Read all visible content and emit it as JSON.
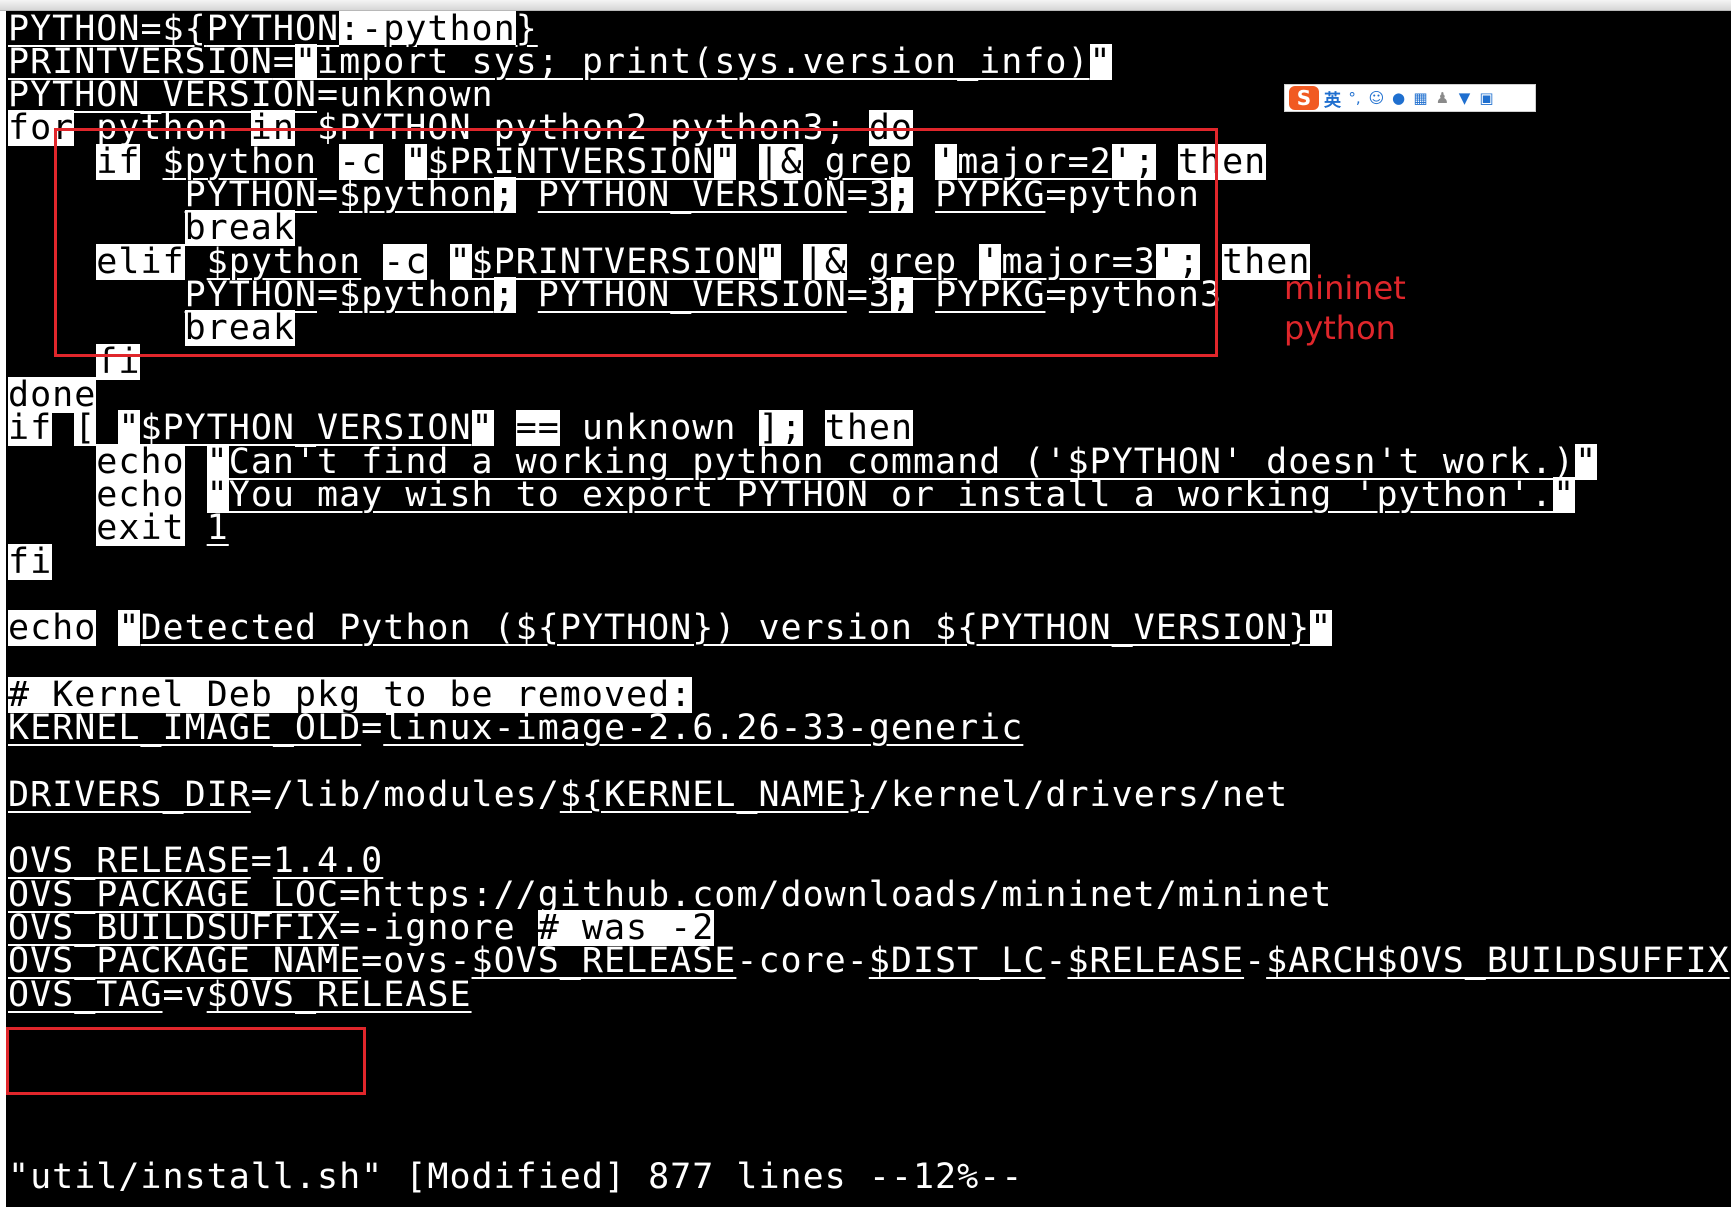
{
  "editor": {
    "lines": [
      {
        "segs": [
          {
            "t": "PYTHON",
            "u": 1
          },
          {
            "t": "=",
            "u": 1
          },
          {
            "t": "${",
            "u": 1
          },
          {
            "t": "PYTHON",
            "u": 1
          },
          {
            "t": ":-python",
            "u": 1,
            "h": 1
          },
          {
            "t": "}",
            "u": 1
          }
        ]
      },
      {
        "segs": [
          {
            "t": "PRINTVERSION",
            "u": 1
          },
          {
            "t": "=",
            "u": 1
          },
          {
            "t": "\"",
            "h": 1
          },
          {
            "t": "import sys; print(sys.version_info)",
            "u": 1
          },
          {
            "t": "\"",
            "h": 1
          }
        ]
      },
      {
        "segs": [
          {
            "t": "PYTHON_VERSION",
            "u": 1
          },
          {
            "t": "=unknown"
          }
        ]
      },
      {
        "segs": [
          {
            "t": "for",
            "h": 1
          },
          {
            "t": " python "
          },
          {
            "t": "in",
            "h": 1
          },
          {
            "t": " $PYTHON python2 python3; "
          },
          {
            "t": "do",
            "h": 1
          }
        ]
      },
      {
        "segs": [
          {
            "t": "    "
          },
          {
            "t": "if",
            "h": 1
          },
          {
            "t": " "
          },
          {
            "t": "$python",
            "u": 1
          },
          {
            "t": " "
          },
          {
            "t": "-c",
            "h": 1
          },
          {
            "t": " "
          },
          {
            "t": "\"",
            "h": 1
          },
          {
            "t": "$PRINTVERSION",
            "u": 1
          },
          {
            "t": "\"",
            "h": 1
          },
          {
            "t": " "
          },
          {
            "t": "|&",
            "h": 1
          },
          {
            "t": " "
          },
          {
            "t": "grep",
            "u": 1
          },
          {
            "t": " "
          },
          {
            "t": "'",
            "h": 1
          },
          {
            "t": "major=2",
            "u": 1
          },
          {
            "t": "'",
            "h": 1
          },
          {
            "t": ";",
            "h": 1
          },
          {
            "t": " "
          },
          {
            "t": "then",
            "h": 1
          }
        ]
      },
      {
        "segs": [
          {
            "t": "        "
          },
          {
            "t": "PYTHON",
            "u": 1
          },
          {
            "t": "="
          },
          {
            "t": "$python",
            "u": 1
          },
          {
            "t": ";",
            "h": 1
          },
          {
            "t": " "
          },
          {
            "t": "PYTHON_VERSION",
            "u": 1
          },
          {
            "t": "="
          },
          {
            "t": "3",
            "u": 1
          },
          {
            "t": ";",
            "h": 1
          },
          {
            "t": " "
          },
          {
            "t": "PYPKG",
            "u": 1
          },
          {
            "t": "=python"
          }
        ]
      },
      {
        "segs": [
          {
            "t": "        "
          },
          {
            "t": "break",
            "h": 1
          }
        ]
      },
      {
        "segs": [
          {
            "t": "    "
          },
          {
            "t": "elif",
            "h": 1
          },
          {
            "t": " "
          },
          {
            "t": "$python",
            "u": 1
          },
          {
            "t": " "
          },
          {
            "t": "-c",
            "h": 1
          },
          {
            "t": " "
          },
          {
            "t": "\"",
            "h": 1
          },
          {
            "t": "$PRINTVERSION",
            "u": 1
          },
          {
            "t": "\"",
            "h": 1
          },
          {
            "t": " "
          },
          {
            "t": "|&",
            "h": 1
          },
          {
            "t": " "
          },
          {
            "t": "grep",
            "u": 1
          },
          {
            "t": " "
          },
          {
            "t": "'",
            "h": 1
          },
          {
            "t": "major=3",
            "u": 1
          },
          {
            "t": "'",
            "h": 1
          },
          {
            "t": ";",
            "h": 1
          },
          {
            "t": " "
          },
          {
            "t": "then",
            "h": 1
          }
        ]
      },
      {
        "segs": [
          {
            "t": "        "
          },
          {
            "t": "PYTHON",
            "u": 1
          },
          {
            "t": "="
          },
          {
            "t": "$python",
            "u": 1
          },
          {
            "t": ";",
            "h": 1
          },
          {
            "t": " "
          },
          {
            "t": "PYTHON_VERSION",
            "u": 1
          },
          {
            "t": "="
          },
          {
            "t": "3",
            "u": 1
          },
          {
            "t": ";",
            "h": 1
          },
          {
            "t": " "
          },
          {
            "t": "PYPKG",
            "u": 1
          },
          {
            "t": "=python3"
          }
        ]
      },
      {
        "segs": [
          {
            "t": "        "
          },
          {
            "t": "break",
            "h": 1
          }
        ]
      },
      {
        "segs": [
          {
            "t": "    "
          },
          {
            "t": "fi",
            "h": 1
          }
        ]
      },
      {
        "segs": [
          {
            "t": "done",
            "h": 1
          }
        ]
      },
      {
        "segs": [
          {
            "t": "if",
            "h": 1
          },
          {
            "t": " "
          },
          {
            "t": "[",
            "h": 1
          },
          {
            "t": " "
          },
          {
            "t": "\"",
            "h": 1
          },
          {
            "t": "$PYTHON_VERSION",
            "u": 1
          },
          {
            "t": "\"",
            "h": 1
          },
          {
            "t": " "
          },
          {
            "t": "==",
            "h": 1
          },
          {
            "t": " unknown "
          },
          {
            "t": "]",
            "h": 1
          },
          {
            "t": ";",
            "h": 1
          },
          {
            "t": " "
          },
          {
            "t": "then",
            "h": 1
          }
        ]
      },
      {
        "segs": [
          {
            "t": "    "
          },
          {
            "t": "echo",
            "h": 1
          },
          {
            "t": " "
          },
          {
            "t": "\"",
            "h": 1
          },
          {
            "t": "Can't find a working python command ('$PYTHON' doesn't work.)",
            "u": 1
          },
          {
            "t": "\"",
            "h": 1
          }
        ]
      },
      {
        "segs": [
          {
            "t": "    "
          },
          {
            "t": "echo",
            "h": 1
          },
          {
            "t": " "
          },
          {
            "t": "\"",
            "h": 1
          },
          {
            "t": "You may wish to export PYTHON or install a working 'python'.",
            "u": 1
          },
          {
            "t": "\"",
            "h": 1
          }
        ]
      },
      {
        "segs": [
          {
            "t": "    "
          },
          {
            "t": "exit",
            "h": 1
          },
          {
            "t": " "
          },
          {
            "t": "1",
            "u": 1
          }
        ]
      },
      {
        "segs": [
          {
            "t": "fi",
            "h": 1
          }
        ]
      },
      {
        "segs": []
      },
      {
        "segs": [
          {
            "t": "echo",
            "h": 1
          },
          {
            "t": " "
          },
          {
            "t": "\"",
            "h": 1
          },
          {
            "t": "Detected Python (${PYTHON}) version ${PYTHON_VERSION}",
            "u": 1
          },
          {
            "t": "\"",
            "h": 1
          }
        ]
      },
      {
        "segs": []
      },
      {
        "segs": [
          {
            "t": "# Kernel Deb pkg to be removed:",
            "h": 1
          }
        ]
      },
      {
        "segs": [
          {
            "t": "KERNEL_IMAGE_OLD",
            "u": 1
          },
          {
            "t": "="
          },
          {
            "t": "linux-image-2.6.26-33-generic",
            "u": 1
          }
        ]
      },
      {
        "segs": []
      },
      {
        "segs": [
          {
            "t": "DRIVERS_DIR",
            "u": 1
          },
          {
            "t": "=/lib/modules/"
          },
          {
            "t": "${KERNEL_NAME}",
            "u": 1
          },
          {
            "t": "/kernel/drivers/net"
          }
        ]
      },
      {
        "segs": []
      },
      {
        "segs": [
          {
            "t": "OVS_RELEASE",
            "u": 1
          },
          {
            "t": "="
          },
          {
            "t": "1.4.0",
            "u": 1
          }
        ]
      },
      {
        "segs": [
          {
            "t": "OVS_PACKAGE_LOC",
            "u": 1
          },
          {
            "t": "=https://github.com/downloads/mininet/mininet"
          }
        ]
      },
      {
        "segs": [
          {
            "t": "OVS_BUILDSUFFIX",
            "u": 1
          },
          {
            "t": "=-ignore "
          },
          {
            "t": "# was -2",
            "h": 1
          }
        ]
      },
      {
        "segs": [
          {
            "t": "OVS_PACKAGE_NAME",
            "u": 1
          },
          {
            "t": "=ovs-"
          },
          {
            "t": "$OVS_RELEASE",
            "u": 1
          },
          {
            "t": "-core-"
          },
          {
            "t": "$DIST_LC",
            "u": 1
          },
          {
            "t": "-"
          },
          {
            "t": "$RELEASE",
            "u": 1
          },
          {
            "t": "-"
          },
          {
            "t": "$ARCH$OVS_BUILDSUFFIX",
            "u": 1
          }
        ]
      },
      {
        "segs": [
          {
            "t": "OVS_TAG",
            "u": 1
          },
          {
            "t": "=v"
          },
          {
            "t": "$OVS_RELEASE",
            "u": 1
          }
        ]
      }
    ],
    "status": {
      "filename": "\"util/install.sh\"",
      "info": " [Modified] 877 lines --12%--"
    }
  },
  "annotations": {
    "note_line1": "mininet",
    "note_line2": "python",
    "color": "#e0262b"
  },
  "ime_toolbar": {
    "logo": "S",
    "lang": "英",
    "icons": [
      "punctuation-icon",
      "emoji-icon",
      "microphone-icon",
      "keyboard-icon",
      "user-icon",
      "shirt-icon",
      "grid-icon"
    ]
  }
}
